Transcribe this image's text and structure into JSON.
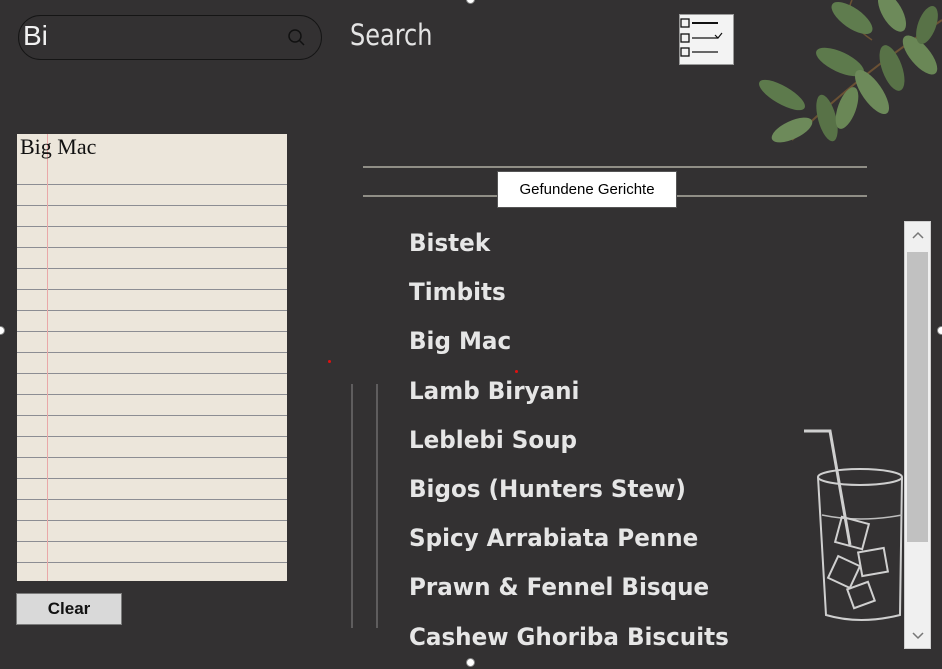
{
  "search": {
    "value": "Bi",
    "label": "Search"
  },
  "notepad": {
    "text": "Big Mac"
  },
  "clear_button": {
    "label": "Clear"
  },
  "results": {
    "header": "Gefundene Gerichte",
    "items": [
      "Bistek",
      "Timbits",
      "Big Mac",
      "Lamb Biryani",
      "Leblebi Soup",
      "Bigos (Hunters Stew)",
      "Spicy Arrabiata Penne",
      "Prawn & Fennel Bisque",
      "Cashew Ghoriba Biscuits"
    ]
  },
  "colors": {
    "background": "#333132",
    "list_text": "#e6e6e6",
    "notepad_paper": "#ece6db"
  },
  "icons": [
    "search-icon",
    "checklist-icon",
    "leaves-decoration",
    "glass-illustration",
    "scroll-up-arrow-icon",
    "scroll-down-arrow-icon"
  ]
}
